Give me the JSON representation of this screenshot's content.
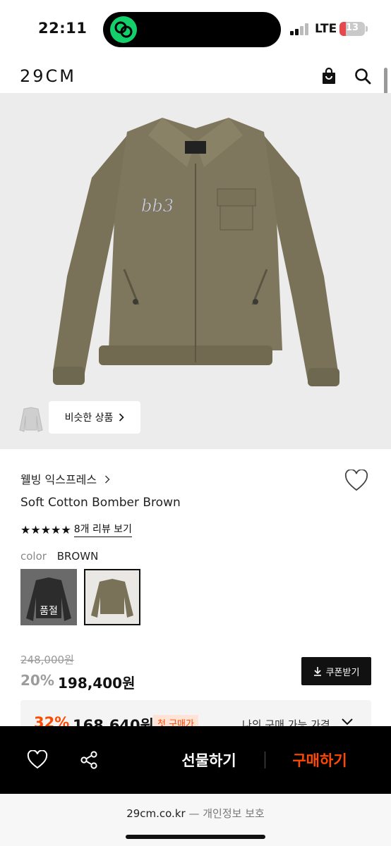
{
  "status_bar": {
    "time": "22:11",
    "network": "LTE",
    "battery": "13",
    "battery_level": 0.13
  },
  "header": {
    "logo": "29CM",
    "icons": [
      "shopping-bag-icon",
      "search-icon"
    ]
  },
  "hero": {
    "similar_button_label": "비슷한 상품"
  },
  "product": {
    "brand": "웰빙 익스프레스",
    "name": "Soft Cotton Bomber Brown",
    "rating_stars": 5,
    "stars_text": "★★★★★",
    "review_link": "8개 리뷰 보기",
    "color_label": "color",
    "color_value": "BROWN",
    "swatches": [
      {
        "color": "BLACK",
        "soldout_label": "품절"
      },
      {
        "color": "BROWN",
        "selected": true
      }
    ]
  },
  "price": {
    "original": "248,000원",
    "discount": "20%",
    "sale": "198,400원",
    "coupon_button": "쿠폰받기",
    "best": {
      "discount": "32%",
      "price": "168,640원",
      "badge": "첫 구매가",
      "my_price_label": "나의 구매 가능 가격"
    }
  },
  "action_bar": {
    "gift_label": "선물하기",
    "buy_label": "구매하기",
    "buy_color": "#ff4800"
  },
  "browser": {
    "domain": "29cm.co.kr",
    "privacy": " — 개인정보 보호"
  }
}
